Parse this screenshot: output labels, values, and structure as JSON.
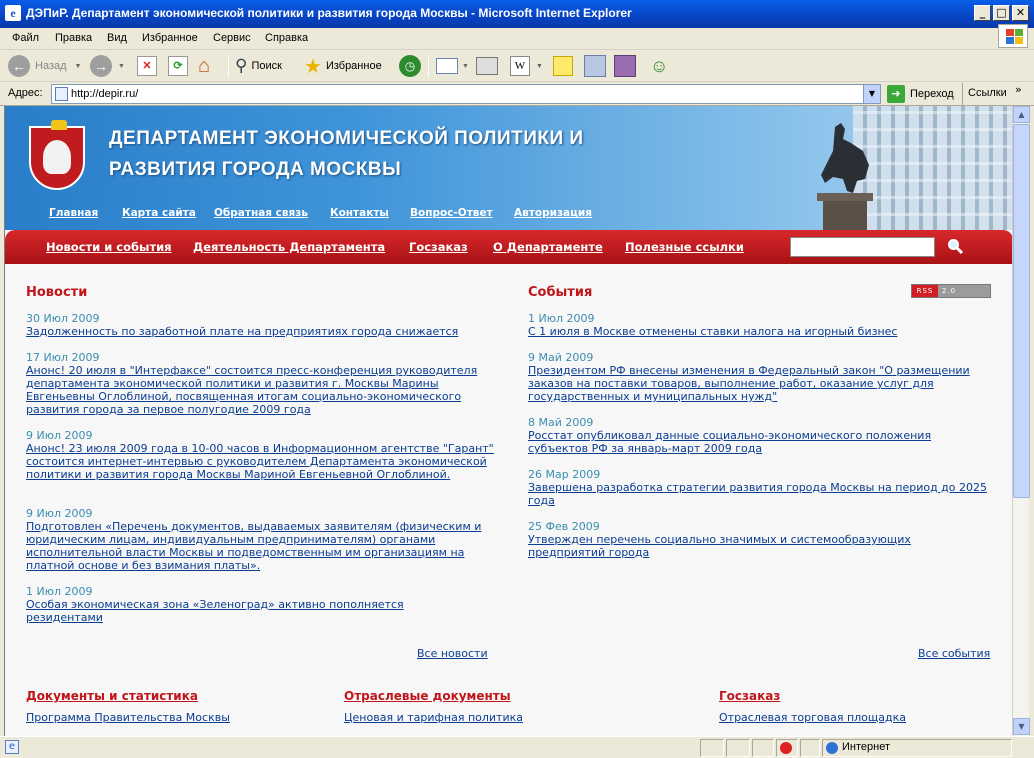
{
  "window": {
    "title": "ДЭПиР. Департамент экономической политики и развития города Москвы - Microsoft Internet Explorer"
  },
  "menu": [
    "Файл",
    "Правка",
    "Вид",
    "Избранное",
    "Сервис",
    "Справка"
  ],
  "toolbar": {
    "back_label": "Назад",
    "search_label": "Поиск",
    "favorites_label": "Избранное"
  },
  "address": {
    "label": "Адрес:",
    "url": "http://depir.ru/",
    "go_label": "Переход",
    "links_label": "Ссылки"
  },
  "header": {
    "title_line1": "ДЕПАРТАМЕНТ ЭКОНОМИЧЕСКОЙ ПОЛИТИКИ И",
    "title_line2": "РАЗВИТИЯ ГОРОДА МОСКВЫ",
    "top_links": [
      "Главная",
      "Карта сайта",
      "Обратная связь",
      "Контакты",
      "Вопрос-Ответ",
      "Авторизация"
    ]
  },
  "nav": [
    "Новости и события",
    "Деятельность Департамента",
    "Госзаказ",
    "О Департаменте",
    "Полезные ссылки"
  ],
  "news": {
    "title": "Новости",
    "items": [
      {
        "date": "30 Июл 2009",
        "text": "Задолженность по заработной плате на предприятиях города снижается"
      },
      {
        "date": "17 Июл 2009",
        "text": "Анонс! 20 июля в \"Интерфаксе\" состоится пресс-конференция руководителя департамента экономической политики и развития г. Москвы Марины Евгеньевны Оглоблиной, посвященная итогам социально-экономического развития города за первое полугодие 2009 года"
      },
      {
        "date": "9 Июл 2009",
        "text": "Анонс! 23 июля 2009 года в 10-00 часов в Информационном агентстве \"Гарант\" состоится интернет-интервью с руководителем Департамента экономической политики и развития города Москвы Мариной Евгеньевной Оглоблиной."
      },
      {
        "date": "9 Июл 2009",
        "text": "Подготовлен «Перечень документов, выдаваемых заявителям (физическим и юридическим лицам, индивидуальным предпринимателям) органами исполнительной власти Москвы и подведомственным им организациям на платной основе и без взимания платы»."
      },
      {
        "date": "1 Июл 2009",
        "text": "Особая экономическая зона «Зеленоград» активно пополняется резидентами"
      }
    ],
    "all_link": "Все новости"
  },
  "events": {
    "title": "События",
    "rss_label": "RSS",
    "rss_version": "2.0",
    "items": [
      {
        "date": "1 Июл 2009",
        "text": "С 1 июля в Москве отменены ставки налога на игорный бизнес"
      },
      {
        "date": "9 Май 2009",
        "text": "Президентом РФ внесены изменения в Федеральный закон \"О размещении заказов на поставки товаров, выполнение работ, оказание услуг для государственных и муниципальных нужд\""
      },
      {
        "date": "8 Май 2009",
        "text": "Росстат опубликовал данные социально-экономического положения субъектов РФ за январь-март 2009 года"
      },
      {
        "date": "26 Мар 2009",
        "text": "Завершена разработка стратегии развития города Москвы на период до 2025 года"
      },
      {
        "date": "25 Фев 2009",
        "text": "Утвержден перечень социально значимых и системообразующих предприятий города"
      }
    ],
    "all_link": "Все события"
  },
  "bottom": {
    "docs_title": "Документы и статистика",
    "docs_item": "Программа Правительства Москвы",
    "industry_title": "Отраслевые документы",
    "industry_item": "Ценовая и тарифная политика",
    "gz_title": "Госзаказ",
    "gz_item": "Отраслевая торговая площадка"
  },
  "status": {
    "zone": "Интернет"
  }
}
